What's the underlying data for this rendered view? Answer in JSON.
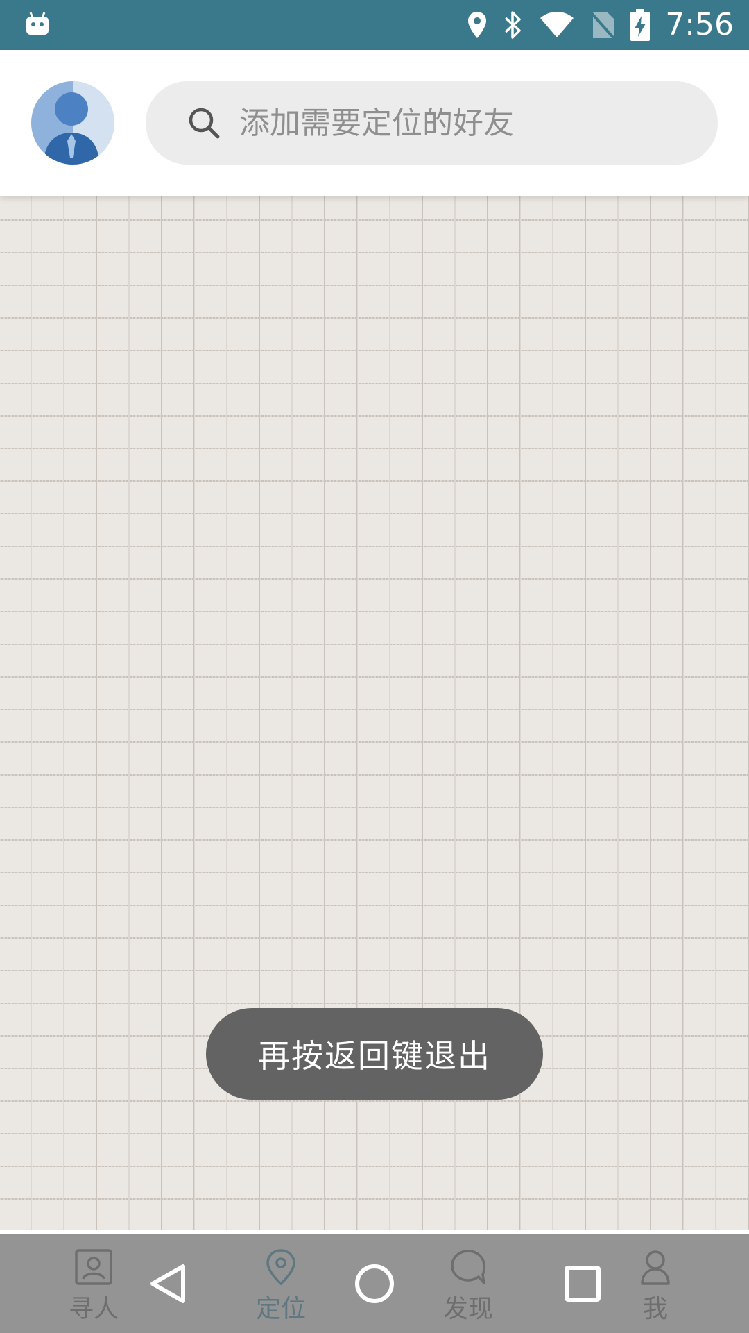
{
  "status_bar": {
    "time": "7:56",
    "background": "#3a798b",
    "icons": [
      "android-icon",
      "location-icon",
      "bluetooth-icon",
      "wifi-icon",
      "no-sim-icon",
      "battery-charging-icon"
    ]
  },
  "header": {
    "avatar_icon": "user-avatar-icon",
    "search": {
      "placeholder": "添加需要定位的好友",
      "value": "",
      "icon": "search-icon"
    }
  },
  "map": {
    "icon": "grid-map-placeholder"
  },
  "toast": {
    "text": "再按返回键退出"
  },
  "tabs": [
    {
      "label": "寻人",
      "icon": "contact-card-icon",
      "active": false
    },
    {
      "label": "定位",
      "icon": "location-pin-icon",
      "active": true
    },
    {
      "label": "发现",
      "icon": "discover-bubble-icon",
      "active": false
    },
    {
      "label": "我",
      "icon": "person-icon",
      "active": false
    }
  ],
  "nav_bar": {
    "buttons": [
      "back-icon",
      "home-icon",
      "recents-icon"
    ]
  },
  "colors": {
    "accent": "#3c8fb0",
    "tab_inactive": "#6f6f6f",
    "toast_bg": "#636363"
  }
}
